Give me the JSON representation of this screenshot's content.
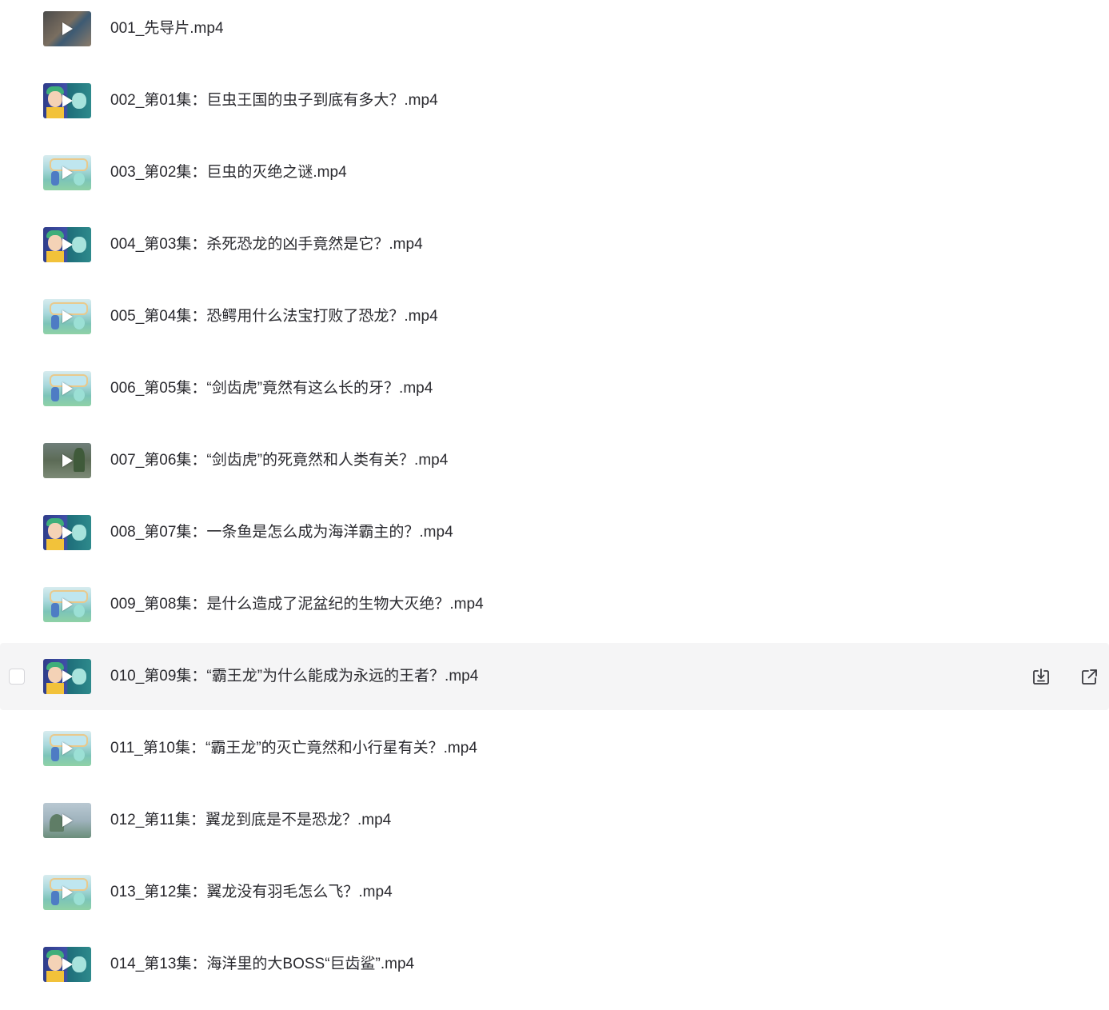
{
  "files": [
    {
      "name": "001_先导片.mp4",
      "thumb": "trailer"
    },
    {
      "name": "002_第01集：巨虫王国的虫子到底有多大？.mp4",
      "thumb": "kids"
    },
    {
      "name": "003_第02集：巨虫的灭绝之谜.mp4",
      "thumb": "room"
    },
    {
      "name": "004_第03集：杀死恐龙的凶手竟然是它？.mp4",
      "thumb": "kids"
    },
    {
      "name": "005_第04集：恐鳄用什么法宝打败了恐龙？.mp4",
      "thumb": "room"
    },
    {
      "name": "006_第05集：“剑齿虎”竟然有这么长的牙？.mp4",
      "thumb": "room"
    },
    {
      "name": "007_第06集：“剑齿虎”的死竟然和人类有关？.mp4",
      "thumb": "nature"
    },
    {
      "name": "008_第07集：一条鱼是怎么成为海洋霸主的？.mp4",
      "thumb": "kids"
    },
    {
      "name": "009_第08集：是什么造成了泥盆纪的生物大灭绝？.mp4",
      "thumb": "room"
    },
    {
      "name": "010_第09集：“霸王龙”为什么能成为永远的王者？.mp4",
      "thumb": "kids",
      "hovered": true
    },
    {
      "name": "011_第10集：“霸王龙”的灭亡竟然和小行星有关？.mp4",
      "thumb": "room"
    },
    {
      "name": "012_第11集：翼龙到底是不是恐龙？.mp4",
      "thumb": "sky"
    },
    {
      "name": "013_第12集：翼龙没有羽毛怎么飞？.mp4",
      "thumb": "room"
    },
    {
      "name": "014_第13集：海洋里的大BOSS“巨齿鲨”.mp4",
      "thumb": "kids"
    }
  ],
  "icons": {
    "play": "play-icon",
    "download": "download-icon",
    "open": "open-external-icon"
  },
  "colors": {
    "text": "#2a2a2f",
    "hover_row": "#f5f5f6"
  }
}
